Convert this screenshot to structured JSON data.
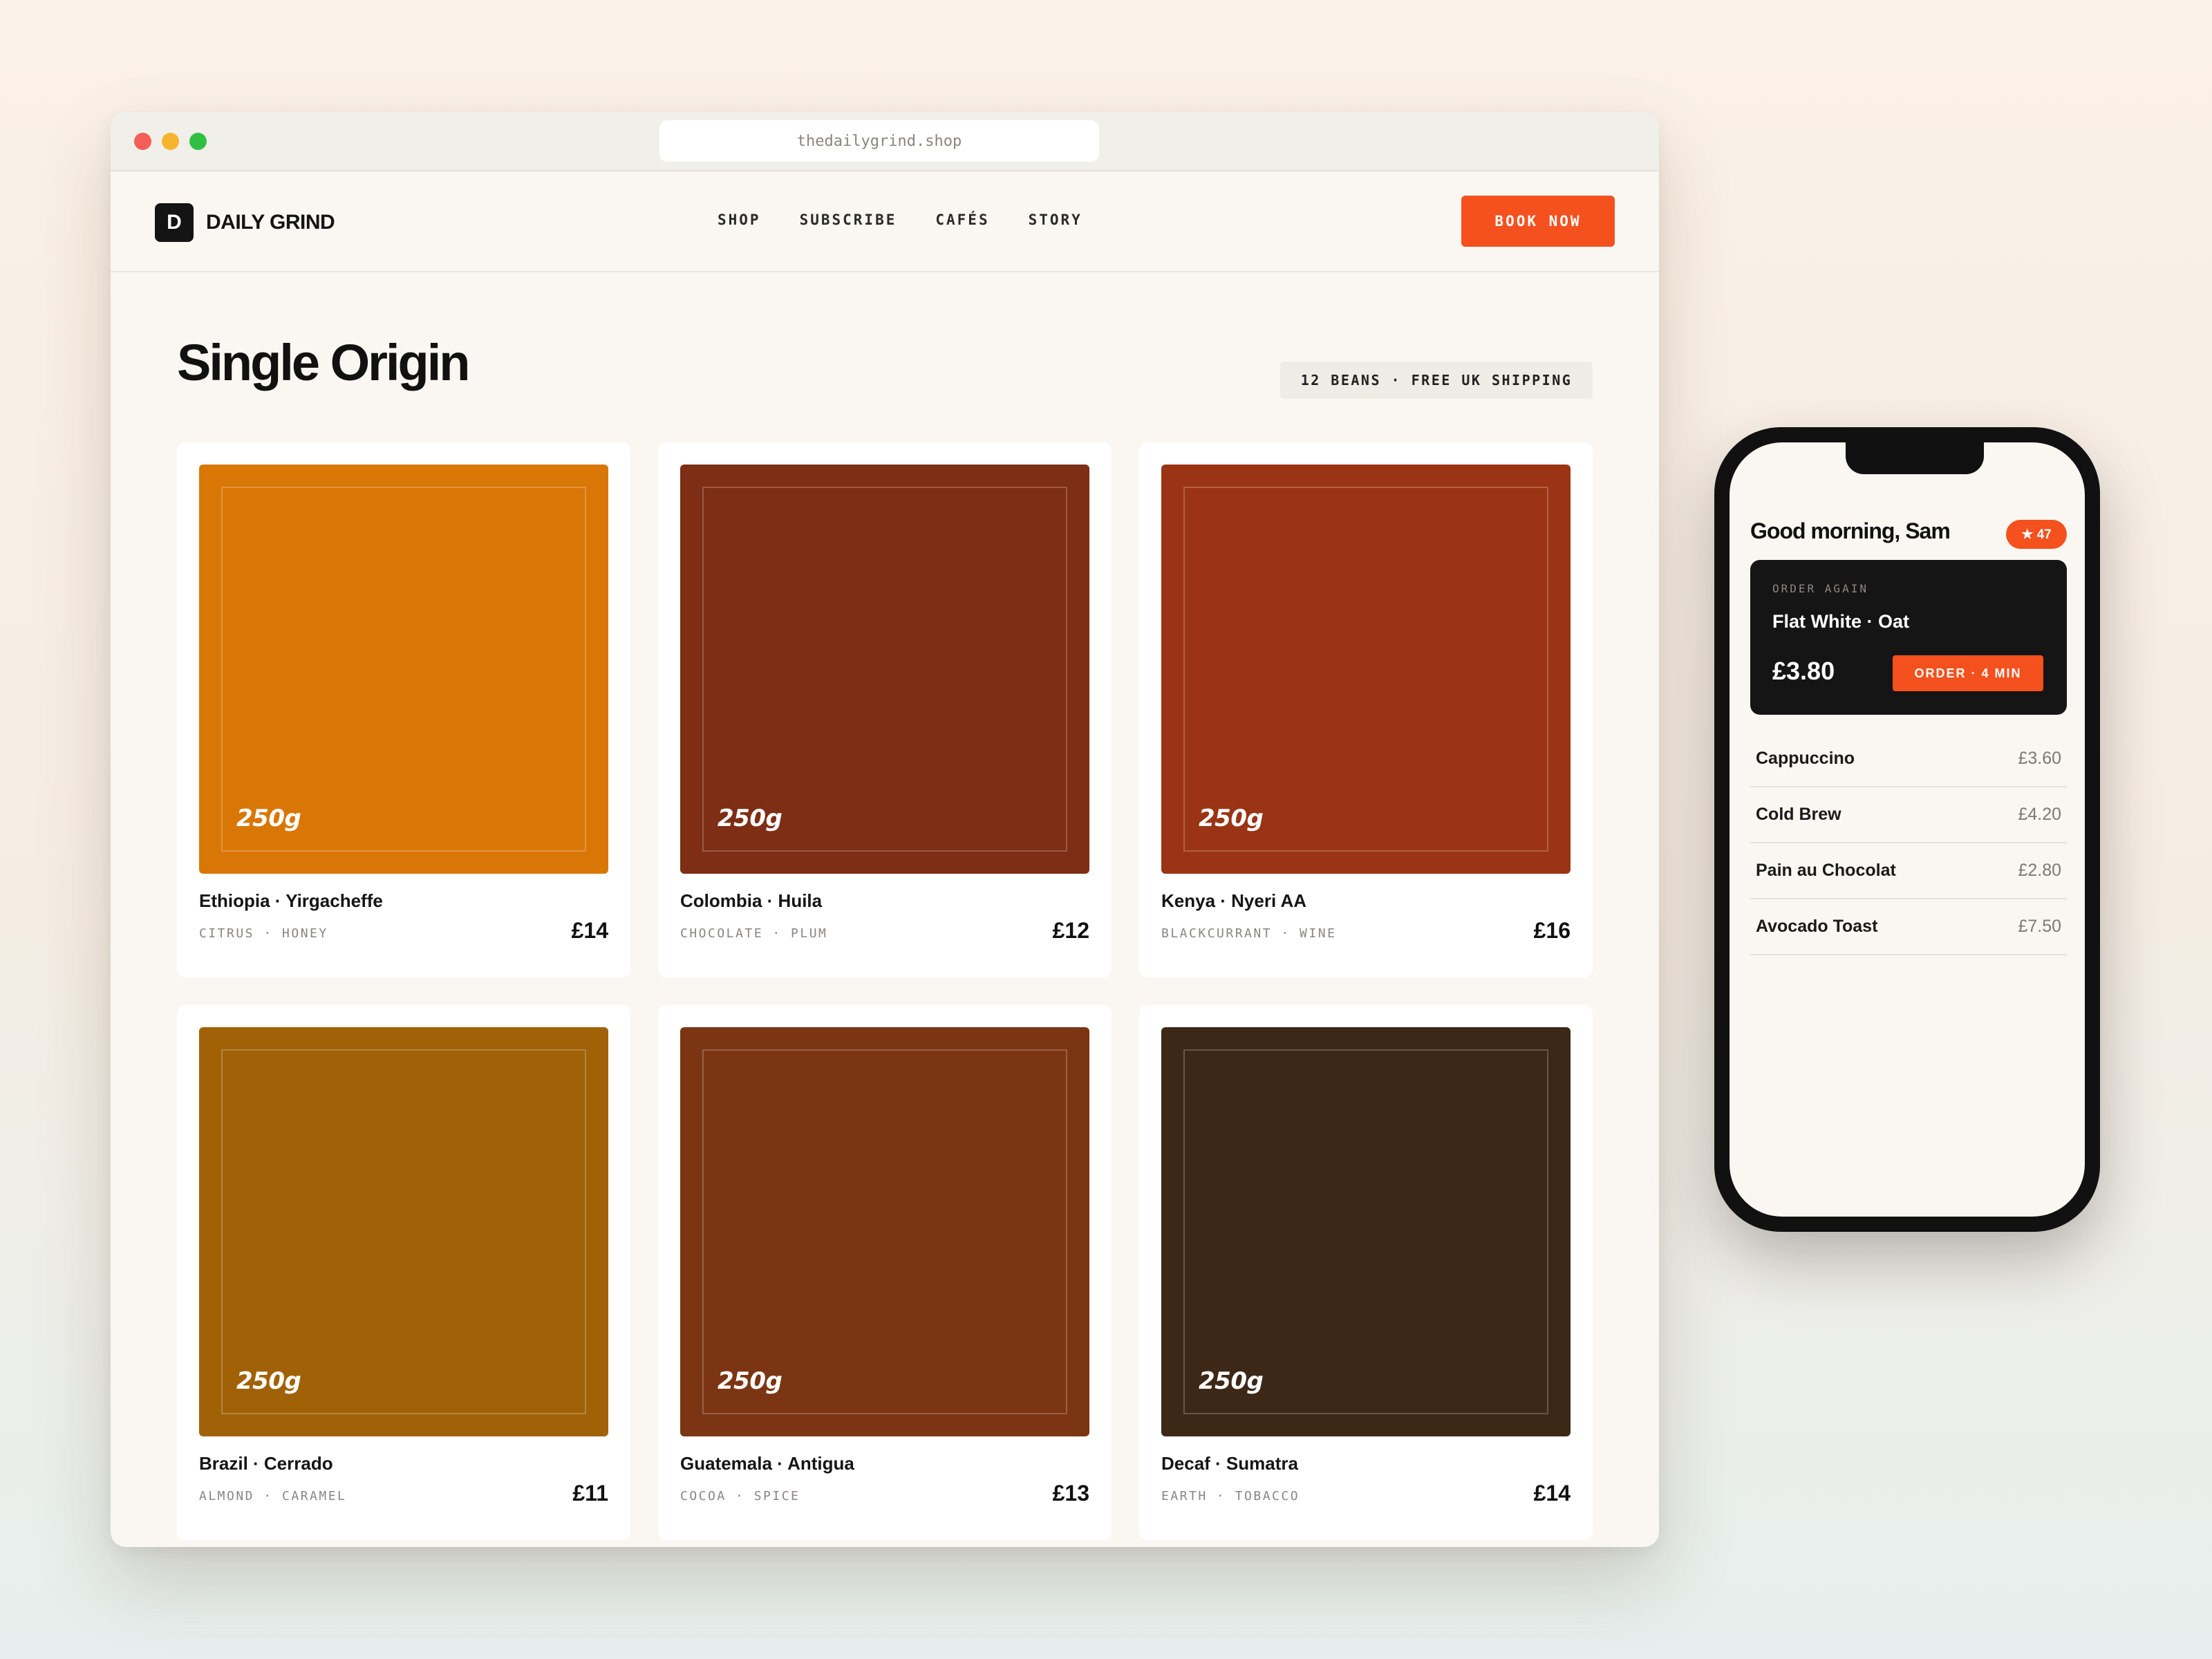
{
  "browser": {
    "url": "thedailygrind.shop"
  },
  "header": {
    "logo_mark": "D",
    "logo_text": "DAILY GRIND",
    "nav": [
      "SHOP",
      "SUBSCRIBE",
      "CAFÉS",
      "STORY"
    ],
    "cta": "BOOK NOW"
  },
  "main": {
    "title": "Single Origin",
    "badge": "12 BEANS · FREE UK SHIPPING",
    "products": [
      {
        "name": "Ethiopia · Yirgacheffe",
        "notes": "CITRUS · HONEY",
        "price": "£14",
        "weight": "250g",
        "color": "#d97706"
      },
      {
        "name": "Colombia · Huila",
        "notes": "CHOCOLATE · PLUM",
        "price": "£12",
        "weight": "250g",
        "color": "#7d2e14"
      },
      {
        "name": "Kenya · Nyeri AA",
        "notes": "BLACKCURRANT · WINE",
        "price": "£16",
        "weight": "250g",
        "color": "#9a3414"
      },
      {
        "name": "Brazil · Cerrado",
        "notes": "ALMOND · CARAMEL",
        "price": "£11",
        "weight": "250g",
        "color": "#a16207"
      },
      {
        "name": "Guatemala · Antigua",
        "notes": "COCOA · SPICE",
        "price": "£13",
        "weight": "250g",
        "color": "#7c3513"
      },
      {
        "name": "Decaf · Sumatra",
        "notes": "EARTH · TOBACCO",
        "price": "£14",
        "weight": "250g",
        "color": "#3d2818"
      }
    ]
  },
  "phone": {
    "greeting": "Good morning, Sam",
    "points": "★ 47",
    "order_again": {
      "label": "ORDER AGAIN",
      "item": "Flat White · Oat",
      "price": "£3.80",
      "button": "ORDER · 4 MIN"
    },
    "menu": [
      {
        "name": "Cappuccino",
        "price": "£3.60"
      },
      {
        "name": "Cold Brew",
        "price": "£4.20"
      },
      {
        "name": "Pain au Chocolat",
        "price": "£2.80"
      },
      {
        "name": "Avocado Toast",
        "price": "£7.50"
      }
    ]
  },
  "colors": {
    "accent": "#f4511e",
    "ink": "#111111",
    "paper": "#faf7f2"
  }
}
